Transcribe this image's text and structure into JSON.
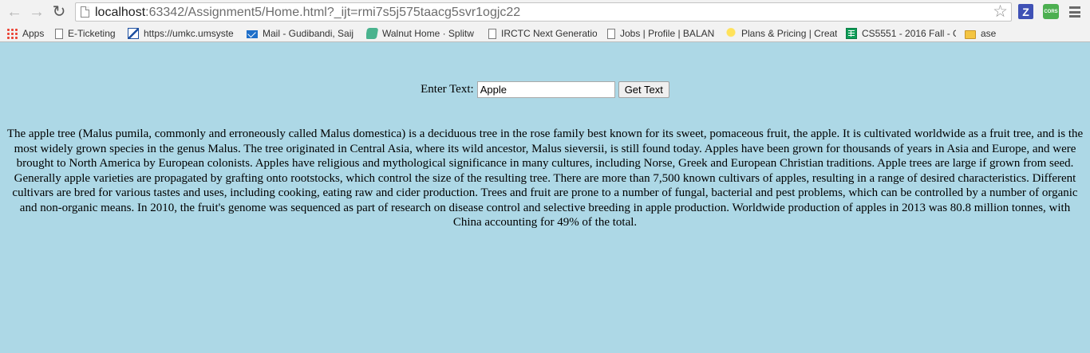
{
  "browser": {
    "url_host": "localhost",
    "url_rest": ":63342/Assignment5/Home.html?_ijt=rmi7s5j575taacg5svr1ogjc22",
    "extensions": {
      "z_label": "Z",
      "cors_label": "CORS"
    }
  },
  "bookmarks": [
    {
      "label": "Apps",
      "icon": "apps-grid-icon"
    },
    {
      "label": "E-Ticketing",
      "icon": "page-icon"
    },
    {
      "label": "https://umkc.umsyste",
      "icon": "umkc-icon"
    },
    {
      "label": "Mail - Gudibandi, Saij",
      "icon": "mail-icon"
    },
    {
      "label": "Walnut Home · Splitw",
      "icon": "walnut-icon"
    },
    {
      "label": "IRCTC Next Generatio",
      "icon": "page-icon"
    },
    {
      "label": "Jobs | Profile | BALAN",
      "icon": "page-icon"
    },
    {
      "label": "Plans & Pricing | Creat",
      "icon": "bulb-icon"
    },
    {
      "label": "CS5551 - 2016 Fall - G",
      "icon": "sheet-icon"
    },
    {
      "label": "ase",
      "icon": "folder-icon"
    }
  ],
  "page": {
    "input_label": "Enter Text:",
    "input_value": "Apple",
    "button_label": "Get Text",
    "result_text": "The apple tree (Malus pumila, commonly and erroneously called Malus domestica) is a deciduous tree in the rose family best known for its sweet, pomaceous fruit, the apple. It is cultivated worldwide as a fruit tree, and is the most widely grown species in the genus Malus. The tree originated in Central Asia, where its wild ancestor, Malus sieversii, is still found today. Apples have been grown for thousands of years in Asia and Europe, and were brought to North America by European colonists. Apples have religious and mythological significance in many cultures, including Norse, Greek and European Christian traditions. Apple trees are large if grown from seed. Generally apple varieties are propagated by grafting onto rootstocks, which control the size of the resulting tree. There are more than 7,500 known cultivars of apples, resulting in a range of desired characteristics. Different cultivars are bred for various tastes and uses, including cooking, eating raw and cider production. Trees and fruit are prone to a number of fungal, bacterial and pest problems, which can be controlled by a number of organic and non-organic means. In 2010, the fruit's genome was sequenced as part of research on disease control and selective breeding in apple production. Worldwide production of apples in 2013 was 80.8 million tonnes, with China accounting for 49% of the total."
  },
  "colors": {
    "page_background": "#add8e6",
    "chrome_background": "#f2f2f2"
  }
}
